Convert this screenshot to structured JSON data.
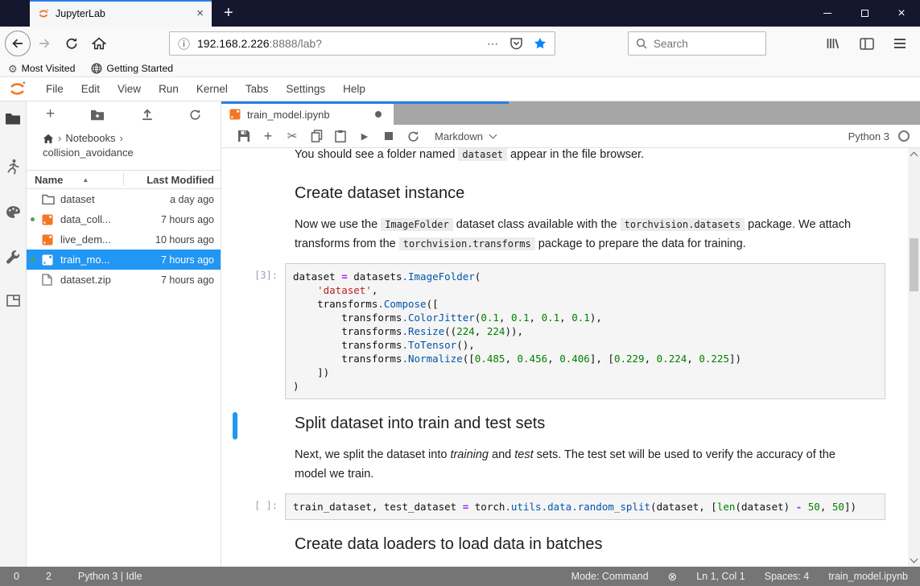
{
  "browser": {
    "tab_title": "JupyterLab",
    "tab_close": "×",
    "new_tab": "+",
    "url_host": "192.168.2.226",
    "url_rest": ":8888/lab?",
    "search_placeholder": "Search",
    "bookmarks": [
      {
        "label": "Most Visited"
      },
      {
        "label": "Getting Started"
      }
    ]
  },
  "icons": {
    "info": "ⓘ",
    "more": "⋯",
    "gear": "⚙",
    "scissors": "✂",
    "sort_asc": "▲",
    "trust": "⊗",
    "crumb_sep": "›",
    "run": "▶",
    "close": "×"
  },
  "menu": {
    "items": [
      "File",
      "Edit",
      "View",
      "Run",
      "Kernel",
      "Tabs",
      "Settings",
      "Help"
    ]
  },
  "filebrowser": {
    "breadcrumb": {
      "line1": "Notebooks",
      "line2": "collision_avoidance"
    },
    "header": {
      "name": "Name",
      "modified": "Last Modified"
    },
    "files": [
      {
        "name": "dataset",
        "modified": "a day ago",
        "icon": "folder",
        "running": false,
        "selected": false
      },
      {
        "name": "data_coll...",
        "modified": "7 hours ago",
        "icon": "notebook",
        "running": true,
        "selected": false
      },
      {
        "name": "live_dem...",
        "modified": "10 hours ago",
        "icon": "notebook",
        "running": false,
        "selected": false
      },
      {
        "name": "train_mo...",
        "modified": "7 hours ago",
        "icon": "notebook",
        "running": true,
        "selected": true
      },
      {
        "name": "dataset.zip",
        "modified": "7 hours ago",
        "icon": "file",
        "running": false,
        "selected": false
      }
    ]
  },
  "notebook": {
    "tab_title": "train_model.ipynb",
    "cell_type": "Markdown",
    "kernel": "Python 3",
    "cells": [
      {
        "kind": "para",
        "clipped": true,
        "segments": [
          [
            "t",
            "You should see a folder named "
          ],
          [
            "c",
            "dataset"
          ],
          [
            "t",
            " appear in the file browser."
          ]
        ]
      },
      {
        "kind": "heading",
        "text": "Create dataset instance"
      },
      {
        "kind": "para",
        "segments": [
          [
            "t",
            "Now we use the "
          ],
          [
            "c",
            "ImageFolder"
          ],
          [
            "t",
            " dataset class available with the "
          ],
          [
            "c",
            "torchvision.datasets"
          ],
          [
            "t",
            " package. We attach transforms from the "
          ],
          [
            "c",
            "torchvision.transforms"
          ],
          [
            "t",
            " package to prepare the data for training."
          ]
        ]
      },
      {
        "kind": "code",
        "prompt": "[3]:",
        "lines": [
          [
            [
              "dataset ",
              ""
            ],
            [
              "=",
              "op"
            ],
            [
              " datasets",
              ""
            ],
            [
              ".ImageFolder",
              "prop"
            ],
            [
              "(",
              ""
            ]
          ],
          [
            [
              "    ",
              ""
            ],
            [
              "'dataset'",
              "str"
            ],
            [
              ",",
              ""
            ]
          ],
          [
            [
              "    transforms",
              ""
            ],
            [
              ".Compose",
              "prop"
            ],
            [
              "([",
              ""
            ]
          ],
          [
            [
              "        transforms",
              ""
            ],
            [
              ".ColorJitter",
              "prop"
            ],
            [
              "(",
              ""
            ],
            [
              "0.1",
              "num"
            ],
            [
              ", ",
              ""
            ],
            [
              "0.1",
              "num"
            ],
            [
              ", ",
              ""
            ],
            [
              "0.1",
              "num"
            ],
            [
              ", ",
              ""
            ],
            [
              "0.1",
              "num"
            ],
            [
              "),",
              ""
            ]
          ],
          [
            [
              "        transforms",
              ""
            ],
            [
              ".Resize",
              "prop"
            ],
            [
              "((",
              ""
            ],
            [
              "224",
              "num"
            ],
            [
              ", ",
              ""
            ],
            [
              "224",
              "num"
            ],
            [
              ")),",
              ""
            ]
          ],
          [
            [
              "        transforms",
              ""
            ],
            [
              ".ToTensor",
              "prop"
            ],
            [
              "(),",
              ""
            ]
          ],
          [
            [
              "        transforms",
              ""
            ],
            [
              ".Normalize",
              "prop"
            ],
            [
              "([",
              ""
            ],
            [
              "0.485",
              "num"
            ],
            [
              ", ",
              ""
            ],
            [
              "0.456",
              "num"
            ],
            [
              ", ",
              ""
            ],
            [
              "0.406",
              "num"
            ],
            [
              "], [",
              ""
            ],
            [
              "0.229",
              "num"
            ],
            [
              ", ",
              ""
            ],
            [
              "0.224",
              "num"
            ],
            [
              ", ",
              ""
            ],
            [
              "0.225",
              "num"
            ],
            [
              "])",
              ""
            ]
          ],
          [
            [
              "    ])",
              ""
            ]
          ],
          [
            [
              ")",
              ""
            ]
          ]
        ]
      },
      {
        "kind": "heading",
        "text": "Split dataset into train and test sets",
        "active": true
      },
      {
        "kind": "para",
        "segments": [
          [
            "t",
            "Next, we split the dataset into "
          ],
          [
            "i",
            "training"
          ],
          [
            "t",
            " and "
          ],
          [
            "i",
            "test"
          ],
          [
            "t",
            " sets. The test set will be used to verify the accuracy of the model we train."
          ]
        ]
      },
      {
        "kind": "code",
        "prompt": "[ ]:",
        "lines": [
          [
            [
              "train_dataset, test_dataset ",
              ""
            ],
            [
              "=",
              "op"
            ],
            [
              " torch",
              ""
            ],
            [
              ".utils",
              "prop"
            ],
            [
              ".data",
              "prop"
            ],
            [
              ".random_split",
              "prop"
            ],
            [
              "(dataset, [",
              ""
            ],
            [
              "len",
              "bi"
            ],
            [
              "(dataset) ",
              ""
            ],
            [
              "-",
              "op"
            ],
            [
              " ",
              ""
            ],
            [
              "50",
              "num"
            ],
            [
              ", ",
              ""
            ],
            [
              "50",
              "num"
            ],
            [
              "])",
              ""
            ]
          ]
        ]
      },
      {
        "kind": "heading",
        "text": "Create data loaders to load data in batches"
      }
    ]
  },
  "statusbar": {
    "left": [
      "0",
      "2",
      "Python 3 | Idle"
    ],
    "mode": "Mode: Command",
    "line_col": "Ln 1, Col 1",
    "spaces": "Spaces: 4",
    "filename": "train_model.ipynb"
  },
  "colors": {
    "accent_blue": "#2196f3",
    "tab_stripe_blue": "#2b7de9",
    "star_blue": "#0a84ff",
    "notebook_orange": "#f37726",
    "running_green": "#4ca64c",
    "titlebar_navy": "#15172e",
    "statusbar_gray": "#757575"
  }
}
